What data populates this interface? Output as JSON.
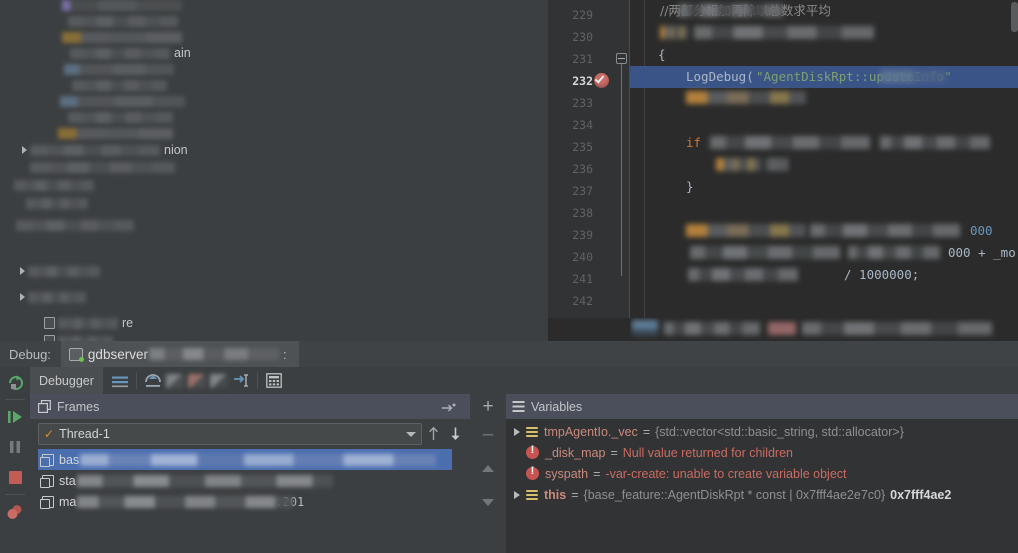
{
  "editor": {
    "first_line": 229,
    "lines": [
      {
        "n": 229,
        "kind": "comment-cjk",
        "text": "//两部分相加再除以总数求平均"
      },
      {
        "n": 230,
        "kind": "redacted"
      },
      {
        "n": 231,
        "kind": "code",
        "text": "{"
      },
      {
        "n": 232,
        "kind": "exec",
        "text": "LogDebug(\"AgentDiskRpt::updateInfo\");"
      },
      {
        "n": 233,
        "kind": "redacted"
      },
      {
        "n": 234,
        "kind": "blank"
      },
      {
        "n": 235,
        "kind": "redacted",
        "keyword": "if"
      },
      {
        "n": 236,
        "kind": "redacted"
      },
      {
        "n": 237,
        "kind": "code",
        "text": "}"
      },
      {
        "n": 238,
        "kind": "blank"
      },
      {
        "n": 239,
        "kind": "redacted",
        "tail": "000"
      },
      {
        "n": 240,
        "kind": "redacted",
        "tail": "000 + _mo"
      },
      {
        "n": 241,
        "kind": "redacted",
        "tail": "/ 1000000;"
      },
      {
        "n": 242,
        "kind": "blank"
      }
    ],
    "exec_line_number": 232,
    "breakpoint_line": 232,
    "breakpoint_icon": "breakpoint-verified-icon",
    "fold_line": 231,
    "code_token_lograw": "LogDebug(",
    "code_token_string": "\"AgentDiskRpt::updateInfo\"",
    "code_token_close": ");",
    "number_literal_1": "1000000",
    "plus_expr": "000 + _mo",
    "trailing_000": "000"
  },
  "debug_window": {
    "label": "Debug:",
    "tab_name": "gdbserver",
    "tab_colon": ":",
    "tab_icon": "remote-debug-icon",
    "run_toolbar": [
      {
        "name": "rerun-button",
        "icon": "rerun-icon"
      },
      {
        "name": "resume-program-button",
        "icon": "resume-icon"
      },
      {
        "name": "pause-program-button",
        "icon": "pause-icon"
      },
      {
        "name": "stop-button",
        "icon": "stop-icon"
      },
      {
        "name": "view-breakpoints-button",
        "icon": "breakpoints-icon"
      }
    ],
    "tabs": [
      {
        "name": "tab-debugger",
        "label": "Debugger"
      }
    ],
    "tab_toolbar": [
      {
        "name": "console-button",
        "icon": "console-lines-icon"
      },
      {
        "name": "step-over-button",
        "icon": "step-over-icon"
      },
      {
        "name": "step-into-button",
        "icon": "step-into-icon"
      },
      {
        "name": "force-step-into-button",
        "icon": "force-step-into-icon"
      },
      {
        "name": "step-out-button",
        "icon": "step-out-icon"
      },
      {
        "name": "run-to-cursor-button",
        "icon": "run-to-cursor-icon"
      },
      {
        "name": "evaluate-expression-button",
        "icon": "calculator-icon"
      }
    ]
  },
  "frames": {
    "title": "Frames",
    "settings_icon": "frames-settings-icon",
    "menu_icon": "frames-menu-icon",
    "thread": {
      "name": "Thread-1",
      "state_icon": "thread-suspended-check-icon",
      "dropdown_icon": "chevron-down-icon",
      "up_icon": "move-up-icon",
      "down_icon": "move-down-icon"
    },
    "rows": [
      {
        "name": "frame-row-0",
        "prefix": "bas",
        "selected": true,
        "tail": ""
      },
      {
        "name": "frame-row-1",
        "prefix": "sta",
        "selected": false,
        "tail": ""
      },
      {
        "name": "frame-row-2",
        "prefix": "ma",
        "selected": false,
        "tail": ":201"
      }
    ]
  },
  "mid_toolbar": {
    "add_label": "+",
    "remove_label": "–",
    "up_icon": "arrow-up-icon",
    "down_icon": "arrow-down-icon",
    "expand_icon": "expand-right-icon"
  },
  "variables": {
    "title": "Variables",
    "menu_icon": "variables-menu-icon",
    "rows": [
      {
        "name": "tmpAgentIo._vec",
        "equals": "=",
        "value": "{std::vector<std::basic_string, std::allocator>}",
        "icon": "list-value-icon",
        "expandable": true,
        "error": false,
        "bold_value": false
      },
      {
        "name": "_disk_map",
        "equals": "=",
        "value": "Null value returned for children",
        "icon": "error-icon",
        "expandable": false,
        "error": true,
        "bold_value": false
      },
      {
        "name": "syspath",
        "equals": "=",
        "value": "-var-create: unable to create variable object",
        "icon": "error-icon",
        "expandable": false,
        "error": true,
        "bold_value": false
      },
      {
        "name": "this",
        "equals": "=",
        "value": "{base_feature::AgentDiskRpt * const | 0x7fff4ae2e7c0}",
        "value_bold": "0x7fff4ae2",
        "icon": "list-value-icon",
        "expandable": true,
        "error": false,
        "bold_value": true
      }
    ]
  },
  "project_tree": {
    "redacted": true,
    "visible_fragments": [
      "ain",
      "nion",
      "re"
    ]
  },
  "colors": {
    "window_bg": "#3c3f41",
    "editor_bg": "#2b2b2b",
    "gutter_bg": "#313335",
    "panel_header_bg": "#4b4f5c",
    "selection_blue": "#4b6eaf",
    "exec_line_blue": "#3a5488",
    "error_red": "#c75450",
    "var_name": "#c98a7d",
    "string_green": "#6a8759",
    "keyword_orange": "#cc7832",
    "number_blue": "#6897bb",
    "function_yellow": "#ffc66d",
    "accent_green": "#70c050"
  }
}
